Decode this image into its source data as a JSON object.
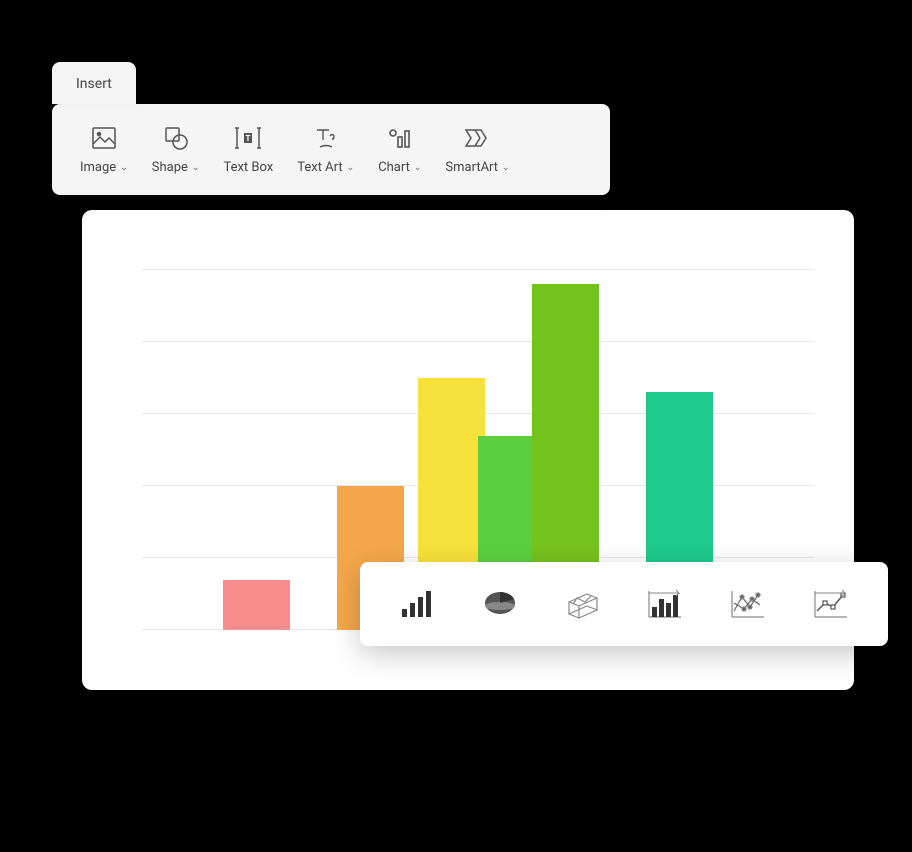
{
  "ribbon": {
    "tab_label": "Insert",
    "items": [
      {
        "label": "Image",
        "has_dropdown": true,
        "icon": "image-icon"
      },
      {
        "label": "Shape",
        "has_dropdown": true,
        "icon": "shape-icon"
      },
      {
        "label": "Text Box",
        "has_dropdown": false,
        "icon": "textbox-icon"
      },
      {
        "label": "Text Art",
        "has_dropdown": true,
        "icon": "textart-icon"
      },
      {
        "label": "Chart",
        "has_dropdown": true,
        "icon": "chart-icon"
      },
      {
        "label": "SmartArt",
        "has_dropdown": true,
        "icon": "smartart-icon"
      }
    ]
  },
  "chart_type_popup": {
    "options": [
      {
        "name": "bar-chart-type"
      },
      {
        "name": "pie-chart-type"
      },
      {
        "name": "surface-chart-type"
      },
      {
        "name": "histogram-chart-type"
      },
      {
        "name": "scatter-chart-type"
      },
      {
        "name": "line-chart-type"
      }
    ]
  },
  "chart_data": {
    "type": "bar",
    "title": "",
    "xlabel": "",
    "ylabel": "",
    "ylim": [
      0,
      100
    ],
    "gridlines": [
      0,
      20,
      40,
      60,
      80,
      100
    ],
    "bars": [
      {
        "x_pct": 12,
        "width_pct": 10,
        "value": 14,
        "color": "#f78e8e"
      },
      {
        "x_pct": 29,
        "width_pct": 10,
        "value": 40,
        "color": "#f4a74a"
      },
      {
        "x_pct": 41,
        "width_pct": 10,
        "value": 70,
        "color": "#f7e13a"
      },
      {
        "x_pct": 50,
        "width_pct": 10,
        "value": 54,
        "color": "#5bcf3e"
      },
      {
        "x_pct": 58,
        "width_pct": 10,
        "value": 96,
        "color": "#74c21c"
      },
      {
        "x_pct": 75,
        "width_pct": 10,
        "value": 66,
        "color": "#1ec98b"
      }
    ],
    "colors": {
      "pink": "#f78e8e",
      "orange": "#f4a74a",
      "yellow": "#f7e13a",
      "green_light": "#5bcf3e",
      "green": "#74c21c",
      "teal": "#1ec98b"
    }
  }
}
